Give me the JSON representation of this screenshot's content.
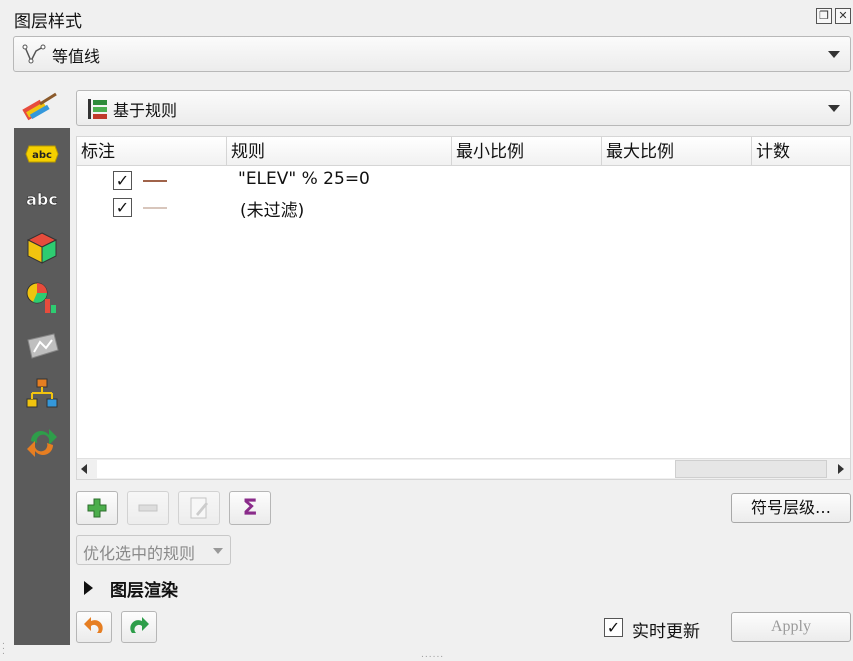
{
  "title": "图层样式",
  "dock_buttons": [
    "restore-icon",
    "close-icon"
  ],
  "layer_combo": {
    "icon": "line-layer-icon",
    "value": "等值线"
  },
  "renderer_combo": {
    "icon": "rule-based-icon",
    "value": "基于规则"
  },
  "sidebar": {
    "top_icon": "paint-brush-icon",
    "items": [
      {
        "name": "labels-icon"
      },
      {
        "name": "abc-icon"
      },
      {
        "name": "3d-box-icon"
      },
      {
        "name": "diagram-icon"
      },
      {
        "name": "3d-view-icon"
      },
      {
        "name": "rendering-icon"
      },
      {
        "name": "actions-icon"
      }
    ]
  },
  "rules_table": {
    "columns": [
      "标注",
      "规则",
      "最小比例",
      "最大比例",
      "计数"
    ],
    "rows": [
      {
        "checked": true,
        "symbol_color": "#a0634a",
        "rule": "\"ELEV\" % 25=0"
      },
      {
        "checked": true,
        "symbol_color": "#d8c6bc",
        "rule": "(未过滤)"
      }
    ]
  },
  "toolbar": {
    "add": "add-rule-icon",
    "remove": "remove-rule-icon",
    "edit": "edit-rule-icon",
    "sum": "Σ"
  },
  "symbol_levels_label": "符号层级…",
  "refine_label": "优化选中的规则",
  "layer_rendering_label": "图层渲染",
  "live_update": {
    "checked": true,
    "label": "实时更新"
  },
  "apply_label": "Apply",
  "colors": {
    "accent_green": "#3a9a3a",
    "sum_purple": "#8a2b8a",
    "sidebar_bg": "#5b5b5b"
  }
}
